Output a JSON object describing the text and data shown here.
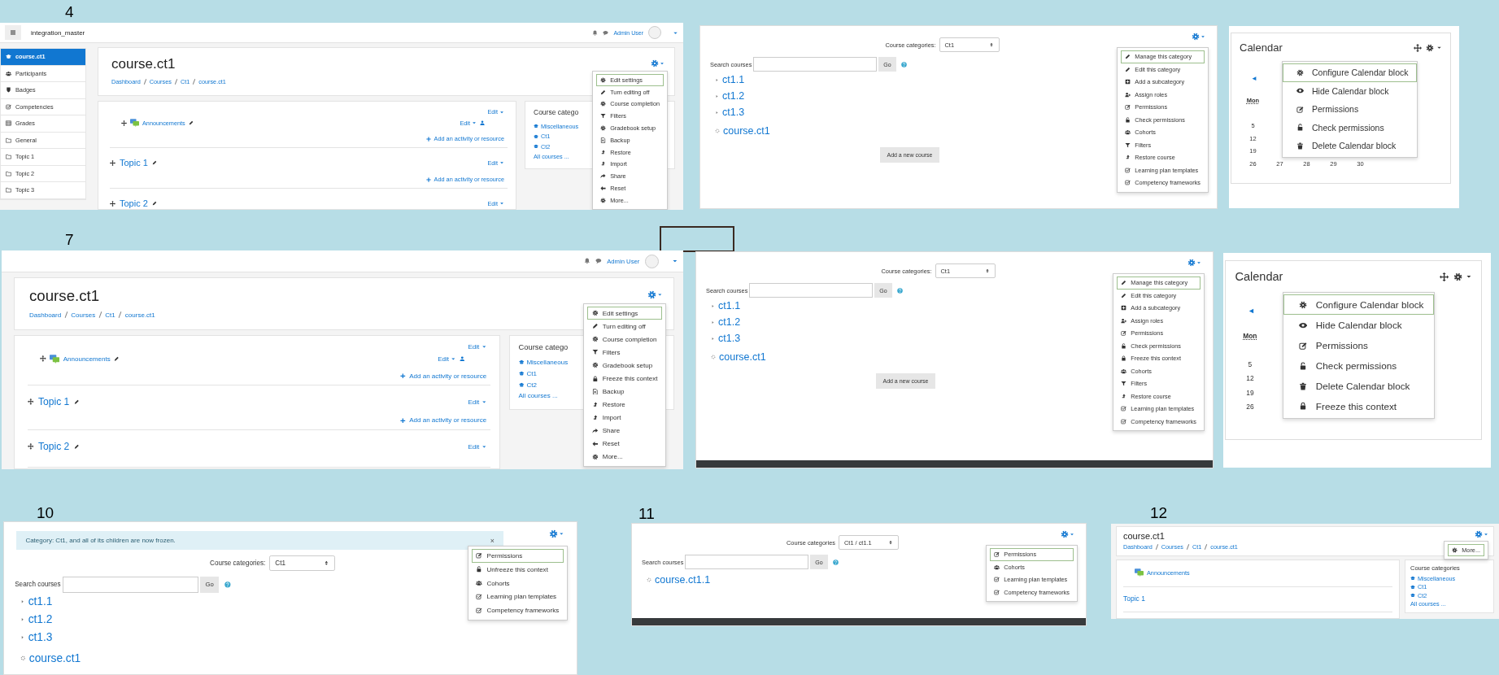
{
  "steps": [
    {
      "number": "4",
      "panels": [
        {
          "kind": "course",
          "topbar": {
            "site_name": "integration_master",
            "user": "Admin User"
          },
          "sidebar": [
            {
              "label": "course.ct1",
              "kind": "cap",
              "selected": true
            },
            {
              "label": "Participants",
              "kind": "people",
              "selected": false
            },
            {
              "label": "Badges",
              "kind": "shield",
              "selected": false
            },
            {
              "label": "Competencies",
              "kind": "checkbox",
              "selected": false
            },
            {
              "label": "Grades",
              "kind": "table",
              "selected": false
            },
            {
              "label": "General",
              "kind": "folder",
              "selected": false
            },
            {
              "label": "Topic 1",
              "kind": "folder",
              "selected": false
            },
            {
              "label": "Topic 2",
              "kind": "folder",
              "selected": false
            },
            {
              "label": "Topic 3",
              "kind": "folder",
              "selected": false
            }
          ],
          "title": "course.ct1",
          "breadcrumb": [
            "Dashboard",
            "Courses",
            "Ct1",
            "course.ct1"
          ],
          "sections": [
            {
              "kind": "general",
              "edit": "Edit",
              "activities": [
                {
                  "name": "Announcements",
                  "edit": "Edit"
                }
              ],
              "add": "Add an activity or resource"
            },
            {
              "kind": "topic",
              "title": "Topic 1",
              "edit": "Edit",
              "add": "Add an activity or resource"
            },
            {
              "kind": "topic",
              "title": "Topic 2",
              "edit": "Edit"
            }
          ],
          "block": {
            "title": "Course catego",
            "items": [
              "Miscellaneous",
              "Ct1",
              "Ct2"
            ],
            "more": "All courses ..."
          },
          "menu": [
            {
              "label": "Edit settings",
              "kind": "settings",
              "selected": true
            },
            {
              "label": "Turn editing off",
              "kind": "pencil",
              "selected": false
            },
            {
              "label": "Course completion",
              "kind": "settings",
              "selected": false
            },
            {
              "label": "Filters",
              "kind": "filter",
              "selected": false
            },
            {
              "label": "Gradebook setup",
              "kind": "settings",
              "selected": false
            },
            {
              "label": "Backup",
              "kind": "file",
              "selected": false
            },
            {
              "label": "Restore",
              "kind": "upload",
              "selected": false
            },
            {
              "label": "Import",
              "kind": "upload",
              "selected": false
            },
            {
              "label": "Share",
              "kind": "share",
              "selected": false
            },
            {
              "label": "Reset",
              "kind": "back",
              "selected": false
            },
            {
              "label": "More...",
              "kind": "settings",
              "selected": false
            }
          ]
        },
        {
          "kind": "category",
          "categories_label": "Course categories:",
          "category": "Ct1",
          "search_label": "Search courses",
          "go": "Go",
          "subcategories": [
            "ct1.1",
            "ct1.2",
            "ct1.3"
          ],
          "courses": [
            "course.ct1"
          ],
          "add_course": "Add a new course",
          "menu": [
            {
              "label": "Manage this category",
              "kind": "pencil",
              "selected": true
            },
            {
              "label": "Edit this category",
              "kind": "pencil",
              "selected": false
            },
            {
              "label": "Add a subcategory",
              "kind": "plusbox",
              "selected": false
            },
            {
              "label": "Assign roles",
              "kind": "personplus",
              "selected": false
            },
            {
              "label": "Permissions",
              "kind": "editsquare",
              "selected": false
            },
            {
              "label": "Check permissions",
              "kind": "unlock",
              "selected": false
            },
            {
              "label": "Cohorts",
              "kind": "people",
              "selected": false
            },
            {
              "label": "Filters",
              "kind": "filter",
              "selected": false
            },
            {
              "label": "Restore course",
              "kind": "upload",
              "selected": false
            },
            {
              "label": "Learning plan templates",
              "kind": "checkbox",
              "selected": false
            },
            {
              "label": "Competency frameworks",
              "kind": "checkbox",
              "selected": false
            }
          ]
        },
        {
          "kind": "calendar",
          "title": "Calendar",
          "prev": "◄",
          "day_header": "Mon",
          "weeks": [
            [
              "5"
            ],
            [
              "12"
            ],
            [
              "19"
            ],
            [
              "26",
              "27",
              "28",
              "29",
              "30"
            ]
          ],
          "menu": [
            {
              "label": "Configure Calendar block",
              "kind": "settings",
              "selected": true
            },
            {
              "label": "Hide Calendar block",
              "kind": "eye",
              "selected": false
            },
            {
              "label": "Permissions",
              "kind": "editsquare",
              "selected": false
            },
            {
              "label": "Check permissions",
              "kind": "unlock",
              "selected": false
            },
            {
              "label": "Delete Calendar block",
              "kind": "trash",
              "selected": false
            }
          ]
        }
      ]
    },
    {
      "number": "7",
      "panels": [
        {
          "kind": "course",
          "topbar": {
            "user": "Admin User"
          },
          "title": "course.ct1",
          "breadcrumb": [
            "Dashboard",
            "Courses",
            "Ct1",
            "course.ct1"
          ],
          "sections": [
            {
              "kind": "general",
              "edit": "Edit",
              "activities": [
                {
                  "name": "Announcements",
                  "edit": "Edit"
                }
              ],
              "add": "Add an activity or resource"
            },
            {
              "kind": "topic",
              "title": "Topic 1",
              "edit": "Edit",
              "add": "Add an activity or resource"
            },
            {
              "kind": "topic",
              "title": "Topic 2",
              "edit": "Edit"
            }
          ],
          "block": {
            "title": "Course catego",
            "items": [
              "Miscellaneous",
              "Ct1",
              "Ct2"
            ],
            "more": "All courses ..."
          },
          "menu": [
            {
              "label": "Edit settings",
              "kind": "settings",
              "selected": true
            },
            {
              "label": "Turn editing off",
              "kind": "pencil",
              "selected": false
            },
            {
              "label": "Course completion",
              "kind": "settings",
              "selected": false
            },
            {
              "label": "Filters",
              "kind": "filter",
              "selected": false
            },
            {
              "label": "Gradebook setup",
              "kind": "settings",
              "selected": false
            },
            {
              "label": "Freeze this context",
              "kind": "lock",
              "selected": false
            },
            {
              "label": "Backup",
              "kind": "file",
              "selected": false
            },
            {
              "label": "Restore",
              "kind": "upload",
              "selected": false
            },
            {
              "label": "Import",
              "kind": "upload",
              "selected": false
            },
            {
              "label": "Share",
              "kind": "share",
              "selected": false
            },
            {
              "label": "Reset",
              "kind": "back",
              "selected": false
            },
            {
              "label": "More...",
              "kind": "settings",
              "selected": false
            }
          ]
        },
        {
          "kind": "category",
          "footer": true,
          "categories_label": "Course categories:",
          "category": "Ct1",
          "search_label": "Search courses",
          "go": "Go",
          "subcategories": [
            "ct1.1",
            "ct1.2",
            "ct1.3"
          ],
          "courses": [
            "course.ct1"
          ],
          "add_course": "Add a new course",
          "menu": [
            {
              "label": "Manage this category",
              "kind": "pencil",
              "selected": true
            },
            {
              "label": "Edit this category",
              "kind": "pencil",
              "selected": false
            },
            {
              "label": "Add a subcategory",
              "kind": "plusbox",
              "selected": false
            },
            {
              "label": "Assign roles",
              "kind": "personplus",
              "selected": false
            },
            {
              "label": "Permissions",
              "kind": "editsquare",
              "selected": false
            },
            {
              "label": "Check permissions",
              "kind": "unlock",
              "selected": false
            },
            {
              "label": "Freeze this context",
              "kind": "lock",
              "selected": false
            },
            {
              "label": "Cohorts",
              "kind": "people",
              "selected": false
            },
            {
              "label": "Filters",
              "kind": "filter",
              "selected": false
            },
            {
              "label": "Restore course",
              "kind": "upload",
              "selected": false
            },
            {
              "label": "Learning plan templates",
              "kind": "checkbox",
              "selected": false
            },
            {
              "label": "Competency frameworks",
              "kind": "checkbox",
              "selected": false
            }
          ]
        },
        {
          "kind": "calendar",
          "title": "Calendar",
          "prev": "◄",
          "day_header": "Mon",
          "weeks": [
            [
              "5"
            ],
            [
              "12"
            ],
            [
              "19"
            ],
            [
              "26"
            ]
          ],
          "menu": [
            {
              "label": "Configure Calendar block",
              "kind": "settings",
              "selected": true
            },
            {
              "label": "Hide Calendar block",
              "kind": "eye",
              "selected": false
            },
            {
              "label": "Permissions",
              "kind": "editsquare",
              "selected": false
            },
            {
              "label": "Check permissions",
              "kind": "unlock",
              "selected": false
            },
            {
              "label": "Delete Calendar block",
              "kind": "trash",
              "selected": false
            },
            {
              "label": "Freeze this context",
              "kind": "lock",
              "selected": false
            }
          ]
        }
      ]
    },
    {
      "number": "10",
      "panels": [
        {
          "kind": "category",
          "alert": "Category: Ct1, and all of its children are now frozen.",
          "alert_close": "×",
          "categories_label": "Course categories:",
          "category": "Ct1",
          "search_label": "Search courses",
          "go": "Go",
          "subcategories": [
            "ct1.1",
            "ct1.2",
            "ct1.3"
          ],
          "courses": [
            "course.ct1"
          ],
          "menu": [
            {
              "label": "Permissions",
              "kind": "editsquare",
              "selected": true
            },
            {
              "label": "Unfreeze this context",
              "kind": "unlock",
              "selected": false
            },
            {
              "label": "Cohorts",
              "kind": "people",
              "selected": false
            },
            {
              "label": "Learning plan templates",
              "kind": "checkbox",
              "selected": false
            },
            {
              "label": "Competency frameworks",
              "kind": "checkbox",
              "selected": false
            }
          ]
        }
      ]
    },
    {
      "number": "11",
      "panels": [
        {
          "kind": "category",
          "footer": true,
          "categories_label": "Course categories",
          "category": "Ct1 / ct1.1",
          "search_label": "Search courses",
          "go": "Go",
          "courses": [
            "course.ct1.1"
          ],
          "menu": [
            {
              "label": "Permissions",
              "kind": "editsquare",
              "selected": true
            },
            {
              "label": "Cohorts",
              "kind": "people",
              "selected": false
            },
            {
              "label": "Learning plan templates",
              "kind": "checkbox",
              "selected": false
            },
            {
              "label": "Competency frameworks",
              "kind": "checkbox",
              "selected": false
            }
          ]
        }
      ]
    },
    {
      "number": "12",
      "panels": [
        {
          "kind": "course",
          "title": "course.ct1",
          "breadcrumb": [
            "Dashboard",
            "Courses",
            "Ct1",
            "course.ct1"
          ],
          "sections": [
            {
              "kind": "general",
              "activities": [
                {
                  "name": "Announcements"
                }
              ]
            },
            {
              "kind": "topic",
              "title": "Topic 1"
            }
          ],
          "block": {
            "title": "Course categories",
            "items": [
              "Miscellaneous",
              "Ct1",
              "Ct2"
            ],
            "more": "All courses ..."
          },
          "menu": [
            {
              "label": "More...",
              "kind": "settings",
              "selected": true
            }
          ]
        }
      ]
    }
  ]
}
